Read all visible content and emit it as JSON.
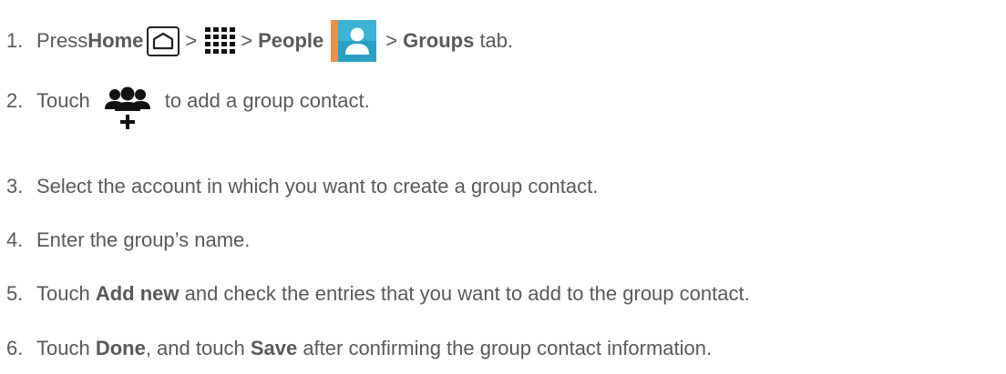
{
  "steps": [
    {
      "num": "1.",
      "parts": {
        "a": "Press ",
        "home": "Home",
        "gt1": ">",
        "gt2": ">",
        "people": "People",
        "gt3": ">",
        "groups": "Groups",
        "tail": " tab."
      }
    },
    {
      "num": "2.",
      "parts": {
        "a": "Touch",
        "b": "to add a group contact."
      }
    },
    {
      "num": "3.",
      "text": "Select the account in which you want to create a group contact."
    },
    {
      "num": "4.",
      "text": "Enter the group’s name."
    },
    {
      "num": "5.",
      "parts": {
        "a": "Touch ",
        "bold": "Add new",
        "b": " and check the entries that you want to add to the group contact."
      }
    },
    {
      "num": "6.",
      "parts": {
        "a": "Touch ",
        "bold1": "Done",
        "b": ", and touch ",
        "bold2": "Save",
        "c": " after confirming the group contact information."
      }
    }
  ],
  "icons": {
    "home": "home-key-icon",
    "apps": "apps-grid-icon",
    "people": "people-app-icon",
    "add_group": "add-group-icon"
  },
  "colors": {
    "text": "#595959",
    "icon_dark": "#222222",
    "people_teal": "#2a9fc4"
  }
}
